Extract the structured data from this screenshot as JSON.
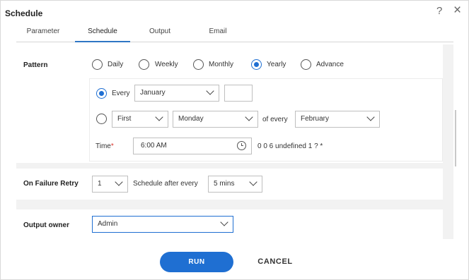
{
  "dialog": {
    "title": "Schedule",
    "help_icon": "?",
    "close_icon": "×"
  },
  "tabs": [
    {
      "label": "Parameter",
      "active": false
    },
    {
      "label": "Schedule",
      "active": true
    },
    {
      "label": "Output",
      "active": false
    },
    {
      "label": "Email",
      "active": false
    }
  ],
  "pattern": {
    "label": "Pattern",
    "options": [
      {
        "label": "Daily",
        "checked": false
      },
      {
        "label": "Weekly",
        "checked": false
      },
      {
        "label": "Monthly",
        "checked": false
      },
      {
        "label": "Yearly",
        "checked": true
      },
      {
        "label": "Advance",
        "checked": false
      }
    ]
  },
  "yearly": {
    "every": {
      "checked": true,
      "label": "Every",
      "month_value": "January",
      "day_value": ""
    },
    "relative": {
      "checked": false,
      "ordinal_value": "First",
      "weekday_value": "Monday",
      "of_every_label": "of every",
      "month_value": "February"
    }
  },
  "time": {
    "label": "Time",
    "required_marker": "*",
    "value": "6:00 AM",
    "cron_text": "0 0 6 undefined 1 ? *"
  },
  "retry": {
    "label": "On Failure Retry",
    "count_value": "1",
    "schedule_label": "Schedule after every",
    "interval_value": "5 mins"
  },
  "owner": {
    "label": "Output owner",
    "value": "Admin"
  },
  "actions": {
    "run_label": "RUN",
    "cancel_label": "CANCEL"
  },
  "colors": {
    "accent": "#1f6fd2",
    "required": "#d9342b",
    "panel_bg": "#f2f2f2"
  },
  "icons": {
    "help": "help-icon",
    "close": "close-icon",
    "dropdown": "chevron-down-icon",
    "time": "clock-icon"
  }
}
